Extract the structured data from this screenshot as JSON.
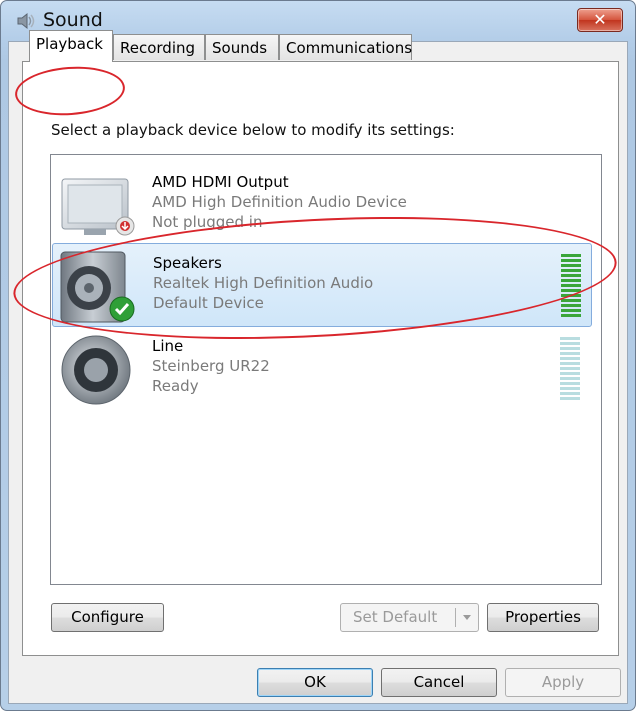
{
  "window": {
    "title": "Sound",
    "close_glyph": "✕"
  },
  "tabs": [
    {
      "label": "Playback",
      "active": true
    },
    {
      "label": "Recording",
      "active": false
    },
    {
      "label": "Sounds",
      "active": false
    },
    {
      "label": "Communications",
      "active": false
    }
  ],
  "instruction": "Select a playback device below to modify its settings:",
  "devices": [
    {
      "name": "AMD HDMI Output",
      "line1": "AMD High Definition Audio Device",
      "line2": "Not plugged in",
      "icon": "monitor-icon",
      "badge": "unplugged-badge-icon",
      "selected": false
    },
    {
      "name": "Speakers",
      "line1": "Realtek High Definition Audio",
      "line2": "Default Device",
      "icon": "speaker-icon",
      "badge": "default-checkmark-icon",
      "selected": true
    },
    {
      "name": "Line",
      "line1": "Steinberg UR22",
      "line2": "Ready",
      "icon": "speaker-icon",
      "badge": "",
      "selected": false
    }
  ],
  "buttons": {
    "configure": "Configure",
    "set_default": "Set Default",
    "properties": "Properties",
    "ok": "OK",
    "cancel": "Cancel",
    "apply": "Apply"
  },
  "colors": {
    "accent": "#84acdd",
    "meter_active": "#3aa53a",
    "meter_idle": "#b9dde0",
    "highlight_circle": "#d9262c"
  }
}
